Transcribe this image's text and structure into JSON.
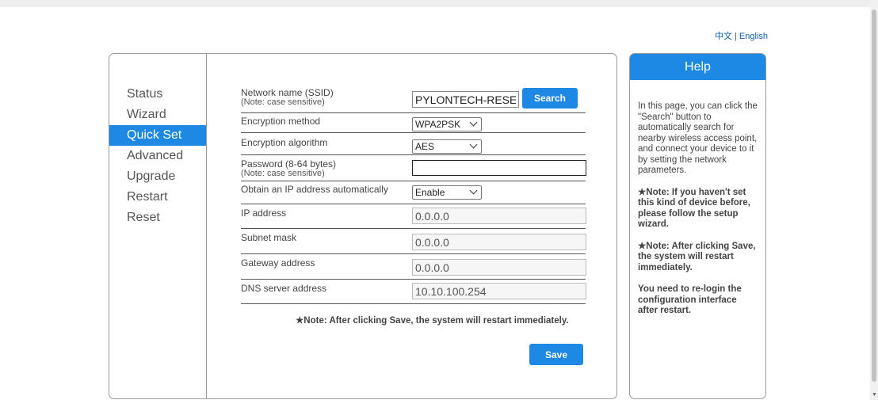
{
  "language": {
    "chinese": "中文",
    "separator": "|",
    "english": "English"
  },
  "nav": {
    "items": [
      {
        "label": "Status"
      },
      {
        "label": "Wizard"
      },
      {
        "label": "Quick Set"
      },
      {
        "label": "Advanced"
      },
      {
        "label": "Upgrade"
      },
      {
        "label": "Restart"
      },
      {
        "label": "Reset"
      }
    ],
    "active": "Quick Set"
  },
  "form": {
    "ssid": {
      "label": "Network name (SSID)",
      "note": "(Note: case sensitive)",
      "value": "PYLONTECH-RESEARCH"
    },
    "search_button": "Search",
    "encryption_method": {
      "label": "Encryption method",
      "value": "WPA2PSK"
    },
    "encryption_algorithm": {
      "label": "Encryption algorithm",
      "value": "AES"
    },
    "password": {
      "label": "Password (8-64 bytes)",
      "note": "(Note: case sensitive)",
      "value": ""
    },
    "obtain_ip": {
      "label": "Obtain an IP address automatically",
      "value": "Enable"
    },
    "ip_address": {
      "label": "IP address",
      "value": "0.0.0.0"
    },
    "subnet_mask": {
      "label": "Subnet mask",
      "value": "0.0.0.0"
    },
    "gateway": {
      "label": "Gateway address",
      "value": "0.0.0.0"
    },
    "dns": {
      "label": "DNS server address",
      "value": "10.10.100.254"
    },
    "note": "★Note: After clicking Save, the system will restart immediately.",
    "save_button": "Save"
  },
  "help": {
    "title": "Help",
    "p1": "In this page, you can click the \"Search\" button to automatically search for nearby wireless access point, and connect your device to it by setting the network parameters.",
    "p2": "★Note: If you haven't set this kind of device before, please follow the setup wizard.",
    "p3": "★Note: After clicking Save, the system will restart immediately.",
    "p4": "You need to re-login the configuration interface after restart."
  }
}
